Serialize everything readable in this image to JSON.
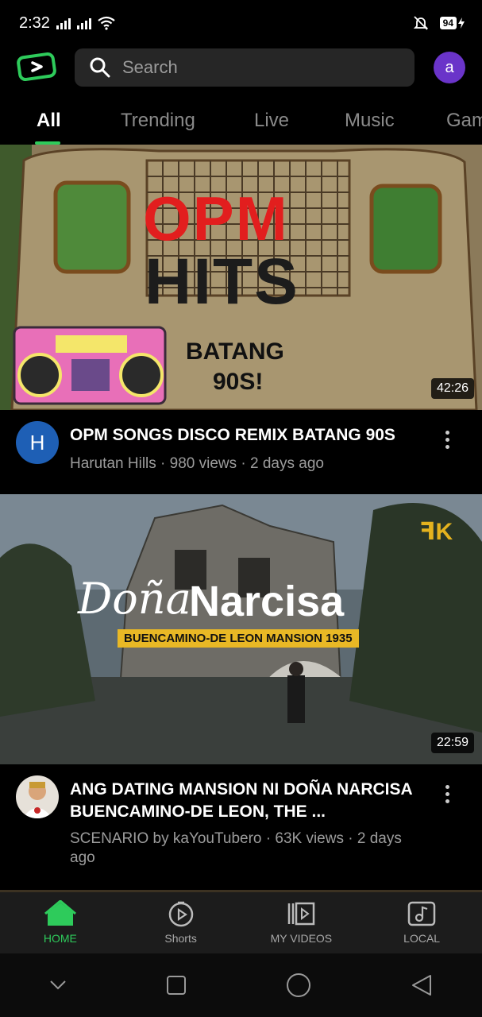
{
  "status_bar": {
    "time": "2:32",
    "battery": "94"
  },
  "search": {
    "placeholder": "Search"
  },
  "account": {
    "initial": "a"
  },
  "tabs": [
    {
      "label": "All",
      "active": true
    },
    {
      "label": "Trending",
      "active": false
    },
    {
      "label": "Live",
      "active": false
    },
    {
      "label": "Music",
      "active": false
    },
    {
      "label": "Gam",
      "active": false
    }
  ],
  "videos": [
    {
      "thumbnail_text": {
        "line1": "OPM",
        "line2": "HITS",
        "sub1": "BATANG",
        "sub2": "90S!"
      },
      "duration": "42:26",
      "channel_initial": "H",
      "title": "OPM SONGS DISCO REMIX BATANG 90S",
      "meta": "Harutan Hills · 980 views · 2 days ago"
    },
    {
      "thumbnail_text": {
        "line1": "Doña",
        "line2": "Narcisa",
        "banner": "BUENCAMINO-DE LEON MANSION 1935"
      },
      "duration": "22:59",
      "title": "ANG DATING MANSION NI DOÑA NARCISA BUENCAMINO-DE LEON, THE ...",
      "meta": "SCENARIO by kaYouTubero · 63K views · 2 days ago"
    }
  ],
  "bottom_nav": [
    {
      "label": "HOME",
      "icon": "home-icon",
      "active": true
    },
    {
      "label": "Shorts",
      "icon": "shorts-icon",
      "active": false
    },
    {
      "label": "MY VIDEOS",
      "icon": "my-videos-icon",
      "active": false
    },
    {
      "label": "LOCAL",
      "icon": "local-music-icon",
      "active": false
    }
  ],
  "colors": {
    "accent": "#2ecb5b",
    "avatar": "#6a34c9",
    "background": "#000000"
  }
}
